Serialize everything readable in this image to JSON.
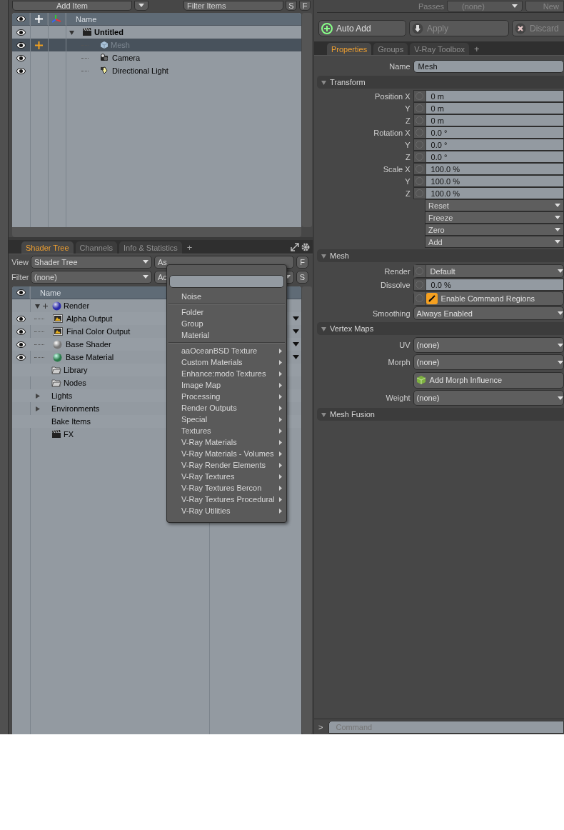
{
  "item_list": {
    "add_item": "Add Item",
    "filter_placeholder": "Filter Items",
    "buttons": [
      "S",
      "F"
    ],
    "name_header": "Name",
    "rows": [
      {
        "name": "Untitled",
        "kind": "scene",
        "selected": false,
        "visible": true,
        "expanded": true,
        "children": [
          {
            "name": "Mesh",
            "kind": "mesh",
            "selected": true,
            "visible": true
          },
          {
            "name": "Camera",
            "kind": "camera",
            "selected": false,
            "visible": true
          },
          {
            "name": "Directional Light",
            "kind": "light",
            "selected": false,
            "visible": true
          }
        ]
      }
    ]
  },
  "shader_panel": {
    "tabs": [
      {
        "label": "Shader Tree",
        "selected": true
      },
      {
        "label": "Channels",
        "selected": false
      },
      {
        "label": "Info & Statistics",
        "selected": false
      }
    ],
    "add_tab": "+",
    "view": {
      "label": "View",
      "value": "Shader Tree",
      "field": "As",
      "button": "F"
    },
    "filter": {
      "label": "Filter",
      "value": "(none)",
      "field": "Ac",
      "button": "S"
    },
    "name_header": "Name",
    "tree": [
      {
        "name": "Render",
        "kind": "render",
        "expanded": true,
        "children": [
          {
            "name": "Alpha Output",
            "kind": "output",
            "visible": true
          },
          {
            "name": "Final Color Output",
            "kind": "output",
            "visible": true
          },
          {
            "name": "Base Shader",
            "kind": "shader",
            "visible": true
          },
          {
            "name": "Base Material",
            "kind": "material",
            "visible": true
          }
        ]
      },
      {
        "name": "Library",
        "kind": "folder"
      },
      {
        "name": "Nodes",
        "kind": "folder"
      },
      {
        "name": "Lights",
        "kind": "group",
        "expanded": false
      },
      {
        "name": "Environments",
        "kind": "group",
        "expanded": false
      },
      {
        "name": "Bake Items",
        "kind": "group"
      },
      {
        "name": "FX",
        "kind": "clapper"
      }
    ]
  },
  "add_menu": {
    "groups": [
      [
        {
          "label": "Noise",
          "submenu": false
        }
      ],
      [
        {
          "label": "Folder",
          "submenu": false
        },
        {
          "label": "Group",
          "submenu": false
        },
        {
          "label": "Material",
          "submenu": false
        }
      ],
      [
        {
          "label": "aaOceanBSD Texture",
          "submenu": true
        },
        {
          "label": "Custom Materials",
          "submenu": true
        },
        {
          "label": "Enhance:modo Textures",
          "submenu": true
        },
        {
          "label": "Image Map",
          "submenu": true
        },
        {
          "label": "Processing",
          "submenu": true
        },
        {
          "label": "Render Outputs",
          "submenu": true
        },
        {
          "label": "Special",
          "submenu": true
        },
        {
          "label": "Textures",
          "submenu": true
        },
        {
          "label": "V-Ray Materials",
          "submenu": true
        },
        {
          "label": "V-Ray Materials - Volumes",
          "submenu": true
        },
        {
          "label": "V-Ray Render Elements",
          "submenu": true
        },
        {
          "label": "V-Ray Textures",
          "submenu": true
        },
        {
          "label": "V-Ray Textures Bercon",
          "submenu": true
        },
        {
          "label": "V-Ray Textures Procedural",
          "submenu": true
        },
        {
          "label": "V-Ray Utilities",
          "submenu": true
        }
      ]
    ]
  },
  "passes": {
    "label": "Passes",
    "value": "(none)",
    "new": "New"
  },
  "actions": [
    {
      "label": "Auto Add",
      "kind": "add",
      "disabled": false
    },
    {
      "label": "Apply",
      "kind": "apply",
      "disabled": true
    },
    {
      "label": "Discard",
      "kind": "discard",
      "disabled": true
    }
  ],
  "properties_tabs": [
    {
      "label": "Properties",
      "selected": true
    },
    {
      "label": "Groups",
      "selected": false
    },
    {
      "label": "V-Ray Toolbox",
      "selected": false
    }
  ],
  "add_tab": "+",
  "name_field": {
    "label": "Name",
    "value": "Mesh"
  },
  "sections": [
    {
      "title": "Transform",
      "expanded": true,
      "rows": [
        {
          "kind": "number",
          "label": "Position X",
          "value": "0 m"
        },
        {
          "kind": "number",
          "label": "Y",
          "value": "0 m"
        },
        {
          "kind": "number",
          "label": "Z",
          "value": "0 m"
        },
        {
          "kind": "number",
          "label": "Rotation X",
          "value": "0.0 °"
        },
        {
          "kind": "number",
          "label": "Y",
          "value": "0.0 °"
        },
        {
          "kind": "number",
          "label": "Z",
          "value": "0.0 °"
        },
        {
          "kind": "number",
          "label": "Scale X",
          "value": "100.0 %"
        },
        {
          "kind": "number",
          "label": "Y",
          "value": "100.0 %"
        },
        {
          "kind": "number",
          "label": "Z",
          "value": "100.0 %"
        },
        {
          "kind": "menu",
          "label": "Reset"
        },
        {
          "kind": "menu",
          "label": "Freeze"
        },
        {
          "kind": "menu",
          "label": "Zero"
        },
        {
          "kind": "menu",
          "label": "Add"
        }
      ]
    },
    {
      "title": "Mesh",
      "expanded": true,
      "rows": [
        {
          "kind": "channel_select",
          "label": "Render",
          "value": "Default"
        },
        {
          "kind": "number",
          "label": "Dissolve",
          "value": "0.0 %"
        },
        {
          "kind": "checkbox",
          "label": "Enable Command Regions",
          "checked": true
        },
        {
          "kind": "select",
          "label": "Smoothing",
          "value": "Always Enabled"
        }
      ]
    },
    {
      "title": "Vertex Maps",
      "expanded": true,
      "rows": [
        {
          "kind": "map_select",
          "label": "UV",
          "value": "(none)"
        },
        {
          "kind": "map_select",
          "label": "Morph",
          "value": "(none)"
        },
        {
          "kind": "action",
          "label": "Add Morph Influence"
        },
        {
          "kind": "map_select",
          "label": "Weight",
          "value": "(none)"
        }
      ]
    },
    {
      "title": "Mesh Fusion",
      "expanded": true
    }
  ],
  "command": {
    "prompt": ">",
    "placeholder": "Command"
  }
}
